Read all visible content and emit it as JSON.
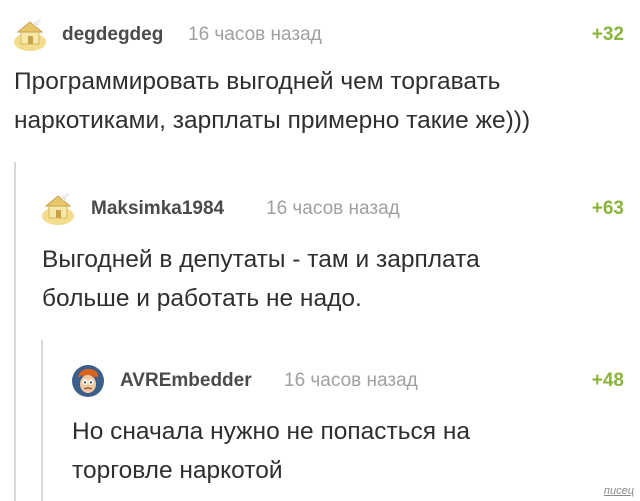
{
  "comments": [
    {
      "username": "degdegdeg",
      "timestamp": "16 часов назад",
      "rating": "+32",
      "text": "Программировать выгодней чем торгавать\nнаркотиками, зарплаты примерно такие же)))",
      "avatar_icon": "default-house-avatar-icon"
    },
    {
      "username": "Maksimka1984",
      "timestamp": "16 часов назад",
      "rating": "+63",
      "text": "Выгодней в депутаты - там и зарплата\nбольше и работать не надо.",
      "avatar_icon": "default-house-avatar-icon"
    },
    {
      "username": "AVREmbedder",
      "timestamp": "16 часов назад",
      "rating": "+48",
      "text": "Но сначала нужно не попасться на\nторговле наркотой",
      "avatar_icon": "fry-avatar-icon"
    }
  ],
  "watermark": "писец",
  "colors": {
    "rating": "#8ab43a",
    "username": "#4a4a4a",
    "timestamp": "#a0a0a0",
    "thread_line": "#d8d8d8",
    "avatar_yellow": "#f3dc8c"
  }
}
